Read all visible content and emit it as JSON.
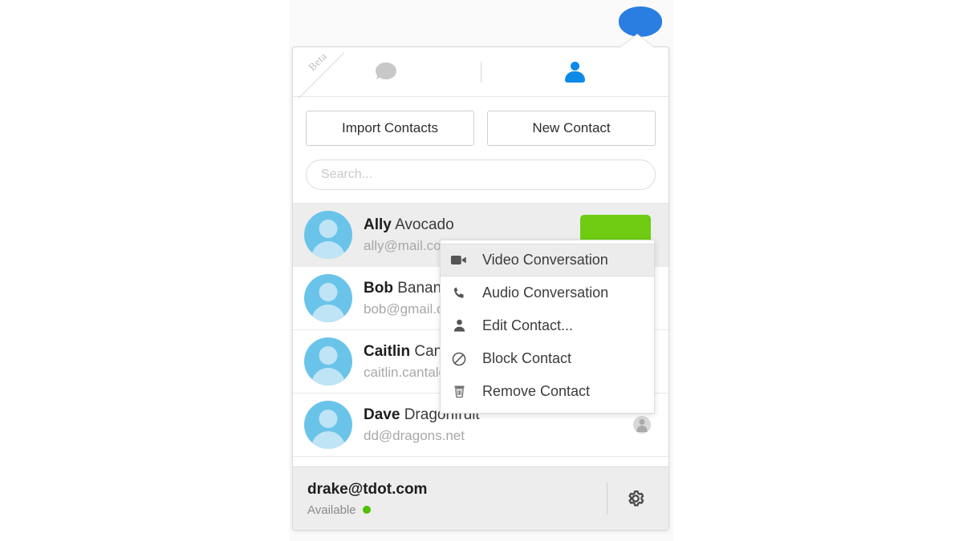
{
  "app": {
    "badge_icon": "chat-bubble-icon",
    "beta_label": "Beta"
  },
  "tabs": [
    {
      "id": "chats",
      "icon": "chat-bubble-icon",
      "active": false
    },
    {
      "id": "contacts",
      "icon": "person-icon",
      "active": true
    }
  ],
  "toolbar": {
    "import_label": "Import Contacts",
    "new_contact_label": "New Contact"
  },
  "search": {
    "value": "",
    "placeholder": "Search..."
  },
  "contacts": [
    {
      "first": "Ally",
      "last": " Avocado",
      "email": "ally@mail.com",
      "selected": true,
      "call_button": true,
      "badge": false
    },
    {
      "first": "Bob",
      "last": " Banana",
      "email": "bob@gmail.com",
      "selected": false,
      "call_button": false,
      "badge": false
    },
    {
      "first": "Caitlin",
      "last": " Cantaloupe",
      "email": "caitlin.cantaloupe@mail.com",
      "selected": false,
      "call_button": false,
      "badge": false
    },
    {
      "first": "Dave",
      "last": " Dragonfruit",
      "email": "dd@dragons.net",
      "selected": false,
      "call_button": false,
      "badge": true
    }
  ],
  "context_menu": {
    "items": [
      {
        "label": "Video Conversation",
        "icon": "video-camera-icon",
        "active": true
      },
      {
        "label": "Audio Conversation",
        "icon": "phone-icon",
        "active": false
      },
      {
        "label": "Edit Contact...",
        "icon": "person-icon",
        "active": false
      },
      {
        "label": "Block Contact",
        "icon": "block-icon",
        "active": false
      },
      {
        "label": "Remove Contact",
        "icon": "trash-icon",
        "active": false
      }
    ]
  },
  "footer": {
    "email": "drake@tdot.com",
    "status": "Available",
    "status_color": "#4fc000",
    "settings_icon": "gear-icon"
  },
  "colors": {
    "accent_blue": "#0d8ae8",
    "badge_blue": "#2a7de1",
    "avatar_blue": "#6ac4ea",
    "call_green": "#6fcc12"
  }
}
